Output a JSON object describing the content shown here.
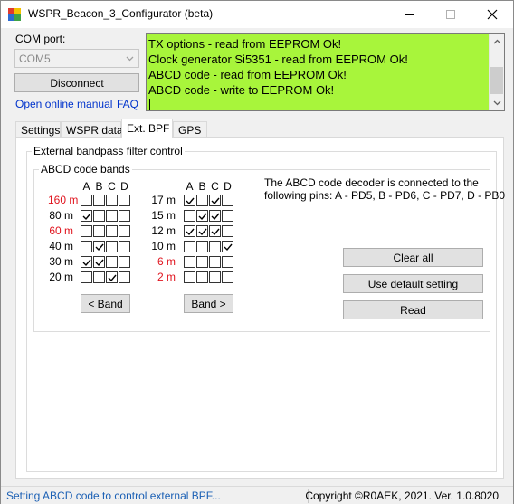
{
  "window": {
    "title": "WSPR_Beacon_3_Configurator (beta)"
  },
  "com": {
    "label": "COM port:",
    "selected": "COM5",
    "disconnect_label": "Disconnect",
    "manual_link": "Open online manual",
    "faq_link": "FAQ"
  },
  "log": {
    "lines": [
      "TX options - read from EEPROM Ok!",
      "Clock generator Si5351 - read from EEPROM Ok!",
      "ABCD code - read from EEPROM Ok!",
      "ABCD code - write to EEPROM Ok!"
    ],
    "background": "#a8f53b"
  },
  "tabs": [
    {
      "label": "Settings",
      "active": false
    },
    {
      "label": "WSPR data",
      "active": false
    },
    {
      "label": "Ext. BPF",
      "active": true
    },
    {
      "label": "GPS",
      "active": false
    }
  ],
  "bpf": {
    "group_title": "External bandpass filter control",
    "abcd_title": "ABCD code bands",
    "columns": [
      "A",
      "B",
      "C",
      "D"
    ],
    "info_text_line1": "The ABCD code decoder is connected to the",
    "info_text_line2": "following pins: A - PD5, B - PD6, C - PD7, D - PB0",
    "left_bands": [
      {
        "label": "160 m",
        "red": true,
        "bits": [
          false,
          false,
          false,
          false
        ]
      },
      {
        "label": "80 m",
        "red": false,
        "bits": [
          true,
          false,
          false,
          false
        ]
      },
      {
        "label": "60 m",
        "red": true,
        "bits": [
          false,
          false,
          false,
          false
        ]
      },
      {
        "label": "40 m",
        "red": false,
        "bits": [
          false,
          true,
          false,
          false
        ]
      },
      {
        "label": "30 m",
        "red": false,
        "bits": [
          true,
          true,
          false,
          false
        ]
      },
      {
        "label": "20 m",
        "red": false,
        "bits": [
          false,
          false,
          true,
          false
        ]
      }
    ],
    "right_bands": [
      {
        "label": "17 m",
        "red": false,
        "bits": [
          true,
          false,
          true,
          false
        ]
      },
      {
        "label": "15 m",
        "red": false,
        "bits": [
          false,
          true,
          true,
          false
        ]
      },
      {
        "label": "12 m",
        "red": false,
        "bits": [
          true,
          true,
          true,
          false
        ]
      },
      {
        "label": "10 m",
        "red": false,
        "bits": [
          false,
          false,
          false,
          true
        ]
      },
      {
        "label": "6 m",
        "red": true,
        "bits": [
          false,
          false,
          false,
          false
        ]
      },
      {
        "label": "2 m",
        "red": true,
        "bits": [
          false,
          false,
          false,
          false
        ]
      }
    ],
    "prev_band_label": "< Band",
    "next_band_label": "Band >",
    "clear_all_label": "Clear all",
    "default_label": "Use default setting",
    "read_label": "Read",
    "red_color": "#e0141e"
  },
  "status": {
    "left": "Setting ABCD code to control external BPF...",
    "right": "Copyright ©R0AEK, 2021. Ver. 1.0.8020"
  }
}
